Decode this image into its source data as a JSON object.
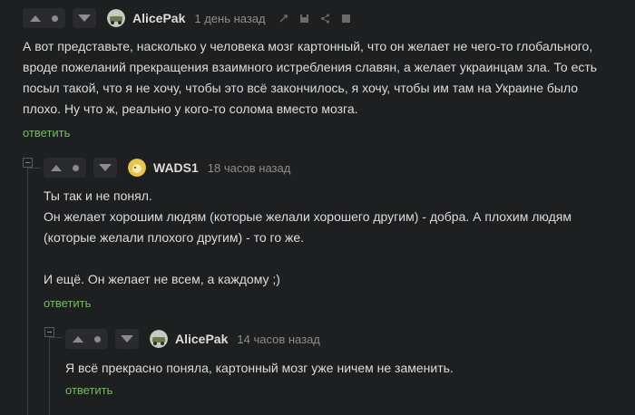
{
  "colors": {
    "background": "#1e1f21",
    "text": "#dcdcdc",
    "muted": "#8d8d8d",
    "reply_link": "#78b865"
  },
  "comments": [
    {
      "author": "AlicePak",
      "time": "1 день назад",
      "avatar_icon": "car-avatar-icon",
      "tools": [
        "link-icon",
        "save-icon",
        "share-icon",
        "report-flag-icon"
      ],
      "paragraphs": [
        "А вот представьте, насколько у человека мозг картонный, что он желает не чего-то глобального,",
        "вроде пожеланий прекращения взаимного истребления славян, а желает украинцам зла. То есть",
        "посыл такой, что я не хочу, чтобы это всё закончилось, я хочу, чтобы им там на Украине было",
        "плохо. Ну что ж, реально у кого-то солома вместо мозга."
      ],
      "reply_label": "ответить"
    },
    {
      "author": "WADS1",
      "time": "18 часов назад",
      "avatar_icon": "chick-avatar-icon",
      "paragraphs": [
        "Ты так и не понял.",
        "Он желает хорошим людям (которые желали хорошего другим) - добра. А плохим людям",
        "(которые желали плохого другим) - то го же.",
        "",
        "И ещё. Он желает не всем, а каждому ;)"
      ],
      "reply_label": "ответить"
    },
    {
      "author": "AlicePak",
      "time": "14 часов назад",
      "avatar_icon": "car-avatar-icon",
      "paragraphs": [
        "Я всё прекрасно поняла, картонный мозг уже ничем не заменить."
      ],
      "reply_label": "ответить"
    }
  ]
}
